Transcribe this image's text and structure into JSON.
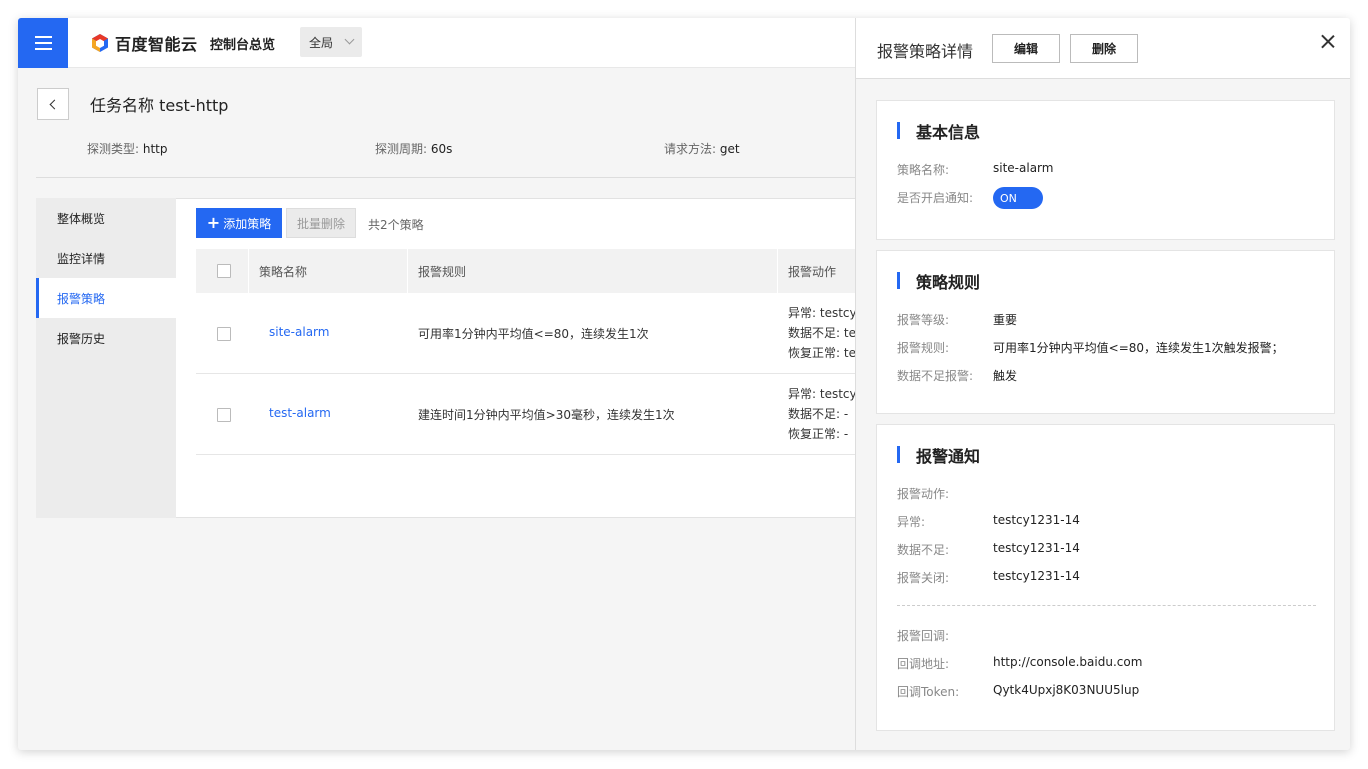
{
  "topbar": {
    "brand": "百度智能云",
    "console_title": "控制台总览",
    "region": "全局"
  },
  "page": {
    "task_name": "任务名称 test-http",
    "meta": [
      {
        "label": "探测类型:",
        "value": "http"
      },
      {
        "label": "探测周期:",
        "value": "60s"
      },
      {
        "label": "请求方法:",
        "value": "get"
      }
    ]
  },
  "sidebar": {
    "items": [
      {
        "label": "整体概览",
        "active": false
      },
      {
        "label": "监控详情",
        "active": false
      },
      {
        "label": "报警策略",
        "active": true
      },
      {
        "label": "报警历史",
        "active": false
      }
    ]
  },
  "toolbar": {
    "add_label": "添加策略",
    "batch_delete_label": "批量删除",
    "total_text": "共2个策略"
  },
  "table": {
    "columns": [
      "策略名称",
      "报警规则",
      "报警动作"
    ],
    "rows": [
      {
        "name": "site-alarm",
        "rule": "可用率1分钟内平均值<=80，连续发生1次",
        "actions": [
          "异常: testcy",
          "数据不足: te",
          "恢复正常: te"
        ]
      },
      {
        "name": "test-alarm",
        "rule": "建连时间1分钟内平均值>30毫秒，连续发生1次",
        "actions": [
          "异常: testcy",
          "数据不足: -",
          "恢复正常: -"
        ]
      }
    ]
  },
  "drawer": {
    "title": "报警策略详情",
    "edit_label": "编辑",
    "delete_label": "删除",
    "basic": {
      "title": "基本信息",
      "name_label": "策略名称:",
      "name_value": "site-alarm",
      "notify_label": "是否开启通知:",
      "toggle_text": "ON"
    },
    "rules": {
      "title": "策略规则",
      "level_label": "报警等级:",
      "level_value": "重要",
      "rule_label": "报警规则:",
      "rule_value": "可用率1分钟内平均值<=80，连续发生1次触发报警；",
      "insufficient_label": "数据不足报警:",
      "insufficient_value": "触发"
    },
    "notify": {
      "title": "报警通知",
      "action_label": "报警动作:",
      "abnormal_label": "异常:",
      "abnormal_value": "testcy1231-14",
      "insufficient_label": "数据不足:",
      "insufficient_value": "testcy1231-14",
      "close_label": "报警关闭:",
      "close_value": "testcy1231-14",
      "callback_label": "报警回调:",
      "url_label": "回调地址:",
      "url_value": "http://console.baidu.com",
      "token_label": "回调Token:",
      "token_value": "Qytk4Upxj8K03NUU5lup"
    }
  },
  "colors": {
    "primary": "#2468f2",
    "sidebar_bg": "#ececec"
  }
}
